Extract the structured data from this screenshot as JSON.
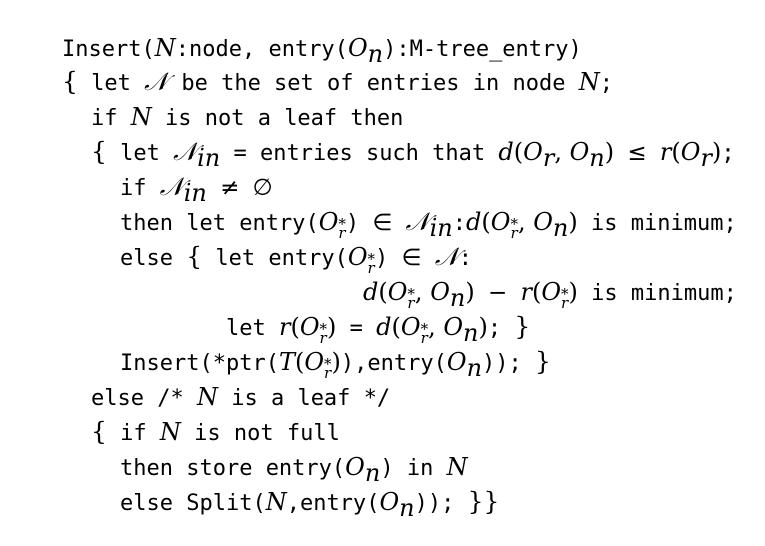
{
  "keywords": {
    "insert": "Insert",
    "entry": "entry",
    "let": "let",
    "be_the_set_of_entries_in_node": "be the set of entries in node",
    "if": "if",
    "is_not_a_leaf_then": "is not a leaf then",
    "entries_such_that": "entries such that",
    "then_let": "then let",
    "is_minimum": "is minimum",
    "else": "else",
    "ptr": "*ptr",
    "comment_open": "/*",
    "is_a_leaf": "is a leaf",
    "comment_close": "*/",
    "is_not_full": "is not full",
    "then_store": "then store",
    "in": "in",
    "split": "Split",
    "node": "node",
    "mtree_entry": "M-tree_entry"
  },
  "vars": {
    "N": "N",
    "O": "O",
    "n": "n",
    "r": "r",
    "d": "d",
    "T": "T",
    "in": "in",
    "star": "*",
    "calN": "𝒩"
  }
}
